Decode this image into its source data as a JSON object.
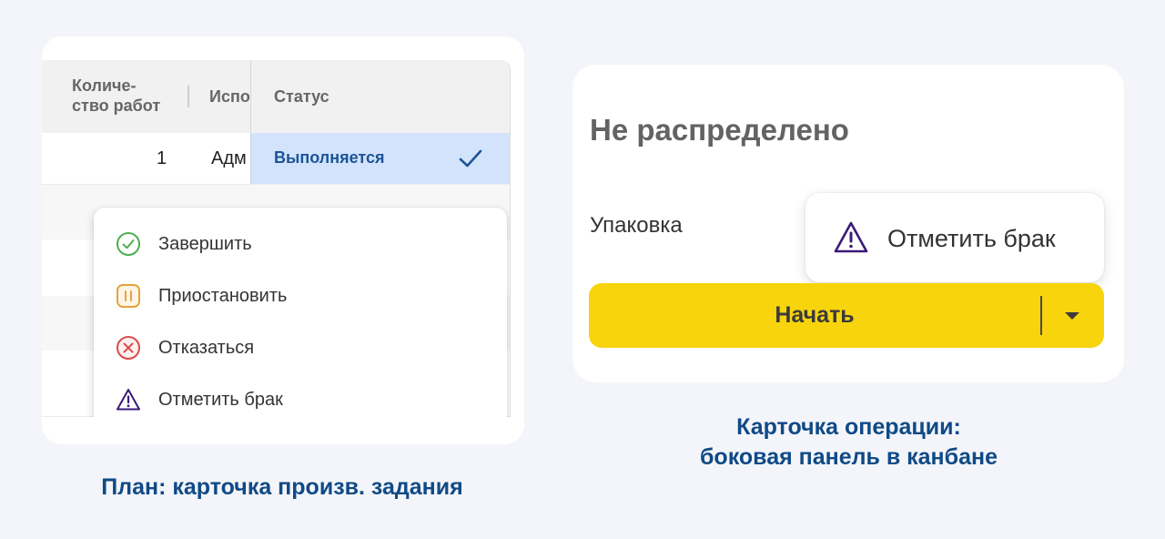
{
  "left_panel": {
    "table": {
      "headers": {
        "qty_line1": "Количе-",
        "qty_line2": "ство работ",
        "executor": "Испо",
        "status": "Статус"
      },
      "row1": {
        "qty": "1",
        "executor": "Адм",
        "status": "Выполняется"
      }
    },
    "menu": [
      {
        "label": "Завершить",
        "icon": "check-circle-icon",
        "color": "#4caf50"
      },
      {
        "label": "Приостановить",
        "icon": "pause-icon",
        "color": "#e6a23c"
      },
      {
        "label": "Отказаться",
        "icon": "cancel-circle-icon",
        "color": "#d84c4c"
      },
      {
        "label": "Отметить брак",
        "icon": "warning-triangle-icon",
        "color": "#3c1a78"
      }
    ],
    "caption": "План: карточка произв. задания"
  },
  "right_panel": {
    "title": "Не распределено",
    "operation_label": "Упаковка",
    "popup_item": {
      "label": "Отметить брак",
      "icon": "warning-triangle-icon",
      "color": "#3c1a78"
    },
    "start_button": {
      "label": "Начать",
      "color": "#f8d40c"
    },
    "caption_line1": "Карточка операции:",
    "caption_line2": "боковая панель в канбане"
  },
  "colors": {
    "accent_blue": "#104a86",
    "status_bg": "#d3e3fb",
    "status_text": "#1d5496"
  }
}
